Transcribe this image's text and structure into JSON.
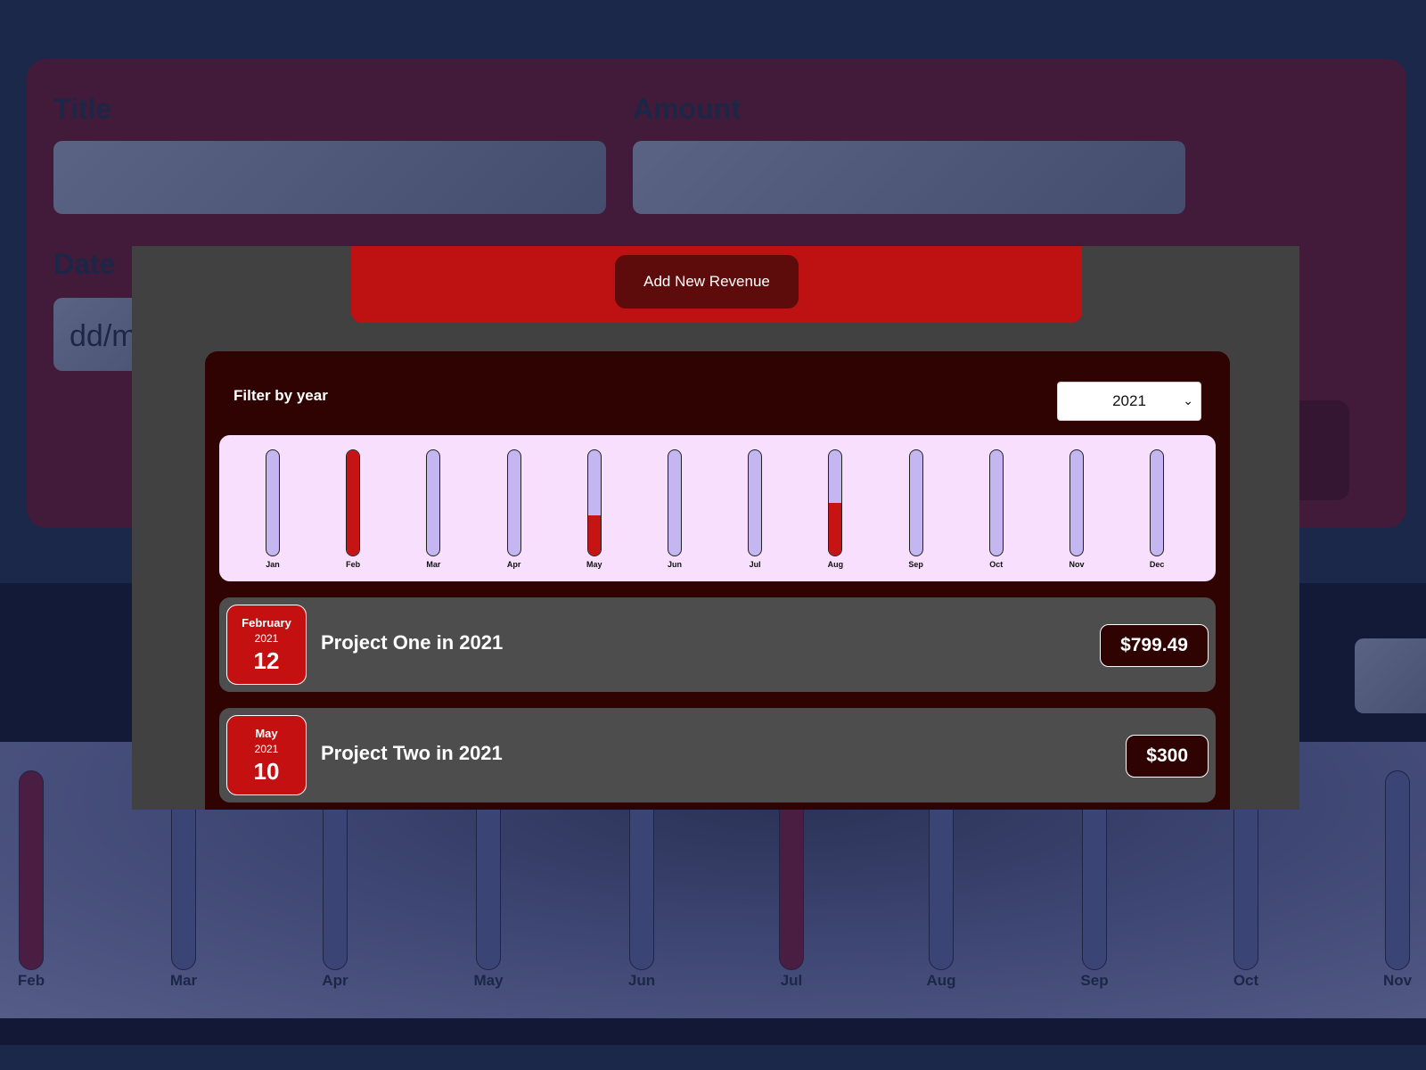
{
  "background": {
    "form": {
      "title_label": "Title",
      "amount_label": "Amount",
      "date_label": "Date",
      "date_placeholder": "dd/m"
    },
    "chart_labels": [
      "Feb",
      "Mar",
      "Apr",
      "May",
      "Jun",
      "Jul",
      "Aug",
      "Sep",
      "Oct",
      "Nov"
    ]
  },
  "modal": {
    "add_button": "Add New Revenue",
    "filter_label": "Filter by year",
    "selected_year": "2021",
    "chart_data": {
      "type": "bar",
      "categories": [
        "Jan",
        "Feb",
        "Mar",
        "Apr",
        "May",
        "Jun",
        "Jul",
        "Aug",
        "Sep",
        "Oct",
        "Nov",
        "Dec"
      ],
      "values": [
        0,
        1.0,
        0,
        0,
        0.38,
        0,
        0,
        0.5,
        0,
        0,
        0,
        0
      ],
      "ylim": [
        0,
        1
      ]
    },
    "items": [
      {
        "month": "February",
        "year": "2021",
        "day": "12",
        "title": "Project One in 2021",
        "amount": "$799.49"
      },
      {
        "month": "May",
        "year": "2021",
        "day": "10",
        "title": "Project Two in 2021",
        "amount": "$300"
      }
    ]
  },
  "colors": {
    "accent": "#be1111",
    "panel": "#300303",
    "bar_track": "#c4b6f0",
    "bar_fill": "#c61313"
  }
}
